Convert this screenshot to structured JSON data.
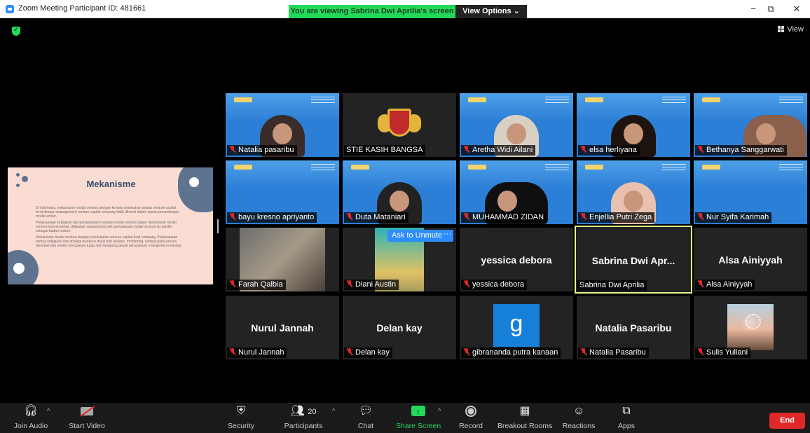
{
  "window": {
    "title": "Zoom Meeting Participant ID: 481661",
    "minimize": "−",
    "restore": "⧉",
    "close": "✕"
  },
  "banner": {
    "viewing": "You are viewing Sabrina Dwi Aprilia's screen",
    "view_options": "View Options ⌄"
  },
  "view_button": "View",
  "slide": {
    "title": "Mekanisme",
    "paragraphs": [
      "Di Indonesia, mekanisme modal ventura dengan konsep pemisahan antara venture capital fund dengan management venture capital company tidak dikenal dalam aturan perundangan modal ventur.",
      "Pelaksanaan kebijakan dan pengelolaan investasi modal ventura dalam mekanisme modal ventura konvensional, dilakukan sepenuhnya oleh perusahaan modal ventura itu sendiri sebagai badan hukum.",
      "Mekanisme modal ventura dengan pendekatan venture capital fund company, Pelaksanaan semua kebijakan dan strategi investasi mulai dari analisis, monitoring, sampai pada proses divestasi dan review merupakan tugas dan tanggung jawab perusahaan manajemen investasi."
    ]
  },
  "participants": [
    {
      "name": "Natalia pasaribu",
      "muted": true,
      "kind": "video"
    },
    {
      "name": "STIE KASIH BANGSA",
      "muted": false,
      "kind": "logo"
    },
    {
      "name": "Aretha Widi Ailani",
      "muted": true,
      "kind": "video"
    },
    {
      "name": "elsa herliyana",
      "muted": true,
      "kind": "video"
    },
    {
      "name": "Bethanya Sanggarwati",
      "muted": true,
      "kind": "video"
    },
    {
      "name": "bayu kresno apriyanto",
      "muted": true,
      "kind": "video"
    },
    {
      "name": "Duta Mataniari",
      "muted": true,
      "kind": "video"
    },
    {
      "name": "MUHAMMAD ZIDAN",
      "muted": true,
      "kind": "video"
    },
    {
      "name": "Enjellia Putri Zega",
      "muted": true,
      "kind": "video"
    },
    {
      "name": "Nur Syifa Karimah",
      "muted": true,
      "kind": "video"
    },
    {
      "name": "Farah Qalbia",
      "muted": true,
      "kind": "video"
    },
    {
      "name": "Diani Austin",
      "muted": true,
      "kind": "video"
    },
    {
      "name": "yessica debora",
      "display": "yessica debora",
      "muted": true,
      "kind": "name"
    },
    {
      "name": "Sabrina Dwi Aprilia",
      "display": "Sabrina  Dwi  Apr...",
      "muted": false,
      "kind": "name",
      "speaking": true
    },
    {
      "name": "Alsa Ainiyyah",
      "display": "Alsa Ainiyyah",
      "muted": true,
      "kind": "name"
    },
    {
      "name": "Nurul Jannah",
      "display": "Nurul Jannah",
      "muted": true,
      "kind": "name"
    },
    {
      "name": "Delan kay",
      "display": "Delan kay",
      "muted": true,
      "kind": "name"
    },
    {
      "name": "gibrananda putra kanaan",
      "avatar_letter": "g",
      "muted": true,
      "kind": "avatar"
    },
    {
      "name": "Natalia Pasaribu",
      "display": "Natalia Pasaribu",
      "muted": true,
      "kind": "name"
    },
    {
      "name": "Sulis Yuliani",
      "muted": true,
      "kind": "photo"
    }
  ],
  "hover_controls": {
    "ask_to_unmute": "Ask to Unmute",
    "more": "···"
  },
  "toolbar": {
    "join_audio": "Join Audio",
    "start_video": "Start Video",
    "security": "Security",
    "participants": "Participants",
    "participant_count": "20",
    "chat": "Chat",
    "share_screen": "Share Screen",
    "record": "Record",
    "breakout_rooms": "Breakout Rooms",
    "reactions": "Reactions",
    "apps": "Apps",
    "end": "End"
  },
  "colors": {
    "zoom_blue": "#2d8cff",
    "share_green": "#23d959",
    "end_red": "#e02828",
    "speaking_border": "#e8f08b"
  }
}
